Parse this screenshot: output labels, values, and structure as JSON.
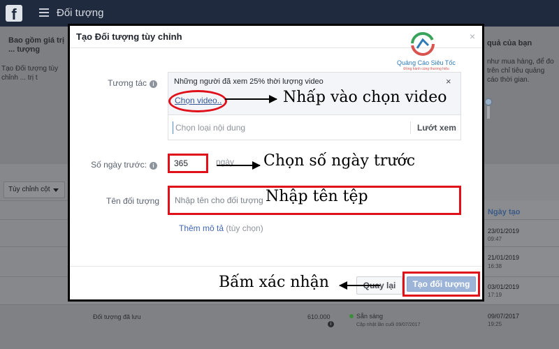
{
  "topbar": {
    "logo": "f",
    "title": "Đối tượng"
  },
  "background": {
    "left_heading": "Bao gồm giá trị ... tượng",
    "left_desc": "Tạo Đối tượng tùy chỉnh ... trị t",
    "right_heading": "quả của bạn",
    "right_desc": "như mua hàng, để đo trên chỉ tiêu quảng cáo thời gian.",
    "columns_button": "Tùy chỉnh cột",
    "date_header": "Ngày tạo",
    "rows": [
      {
        "date": "23/01/2019",
        "time": "09:47"
      },
      {
        "date": "21/01/2019",
        "time": "16:38"
      },
      {
        "date": "03/01/2019",
        "time": "17:19"
      }
    ],
    "saved_row": {
      "name": "Đối tượng đã lưu",
      "size": "610.000",
      "status": "Sẵn sàng",
      "status_sub": "Cập nhật lần cuối 09/07/2017",
      "date": "09/07/2017",
      "time": "19:25"
    }
  },
  "modal": {
    "title": "Tạo Đối tượng tùy chỉnh",
    "close": "×",
    "brand": {
      "name": "Quảng Cáo Siêu Tốc",
      "slogan": "Đồng hành cùng thương hiệu"
    },
    "engagement": {
      "label": "Tương tác",
      "info": "i",
      "box_title": "Những người đã xem 25% thời lượng video",
      "box_close": "×",
      "choose_video": "Chọn video..",
      "search_placeholder": "Chọn loại nội dung",
      "browse": "Lướt xem"
    },
    "days": {
      "label": "Số ngày trước:",
      "info": "i",
      "value": "365",
      "unit": "ngày"
    },
    "audience_name": {
      "label": "Tên đối tượng",
      "placeholder": "Nhập tên cho đối tượng"
    },
    "description": {
      "link": "Thêm mô tả",
      "optional": " (tùy chọn)"
    },
    "buttons": {
      "cancel": "Quay lại",
      "create": "Tạo đối tượng"
    }
  },
  "annotations": {
    "choose_video": "Nhấp vào chọn video",
    "days": "Chọn số ngày trước",
    "name": "Nhập tên tệp",
    "confirm": "Bấm xác nhận"
  },
  "colors": {
    "highlight_red": "#e0101b",
    "link_blue": "#365899",
    "create_button": "#9cb4d8"
  }
}
